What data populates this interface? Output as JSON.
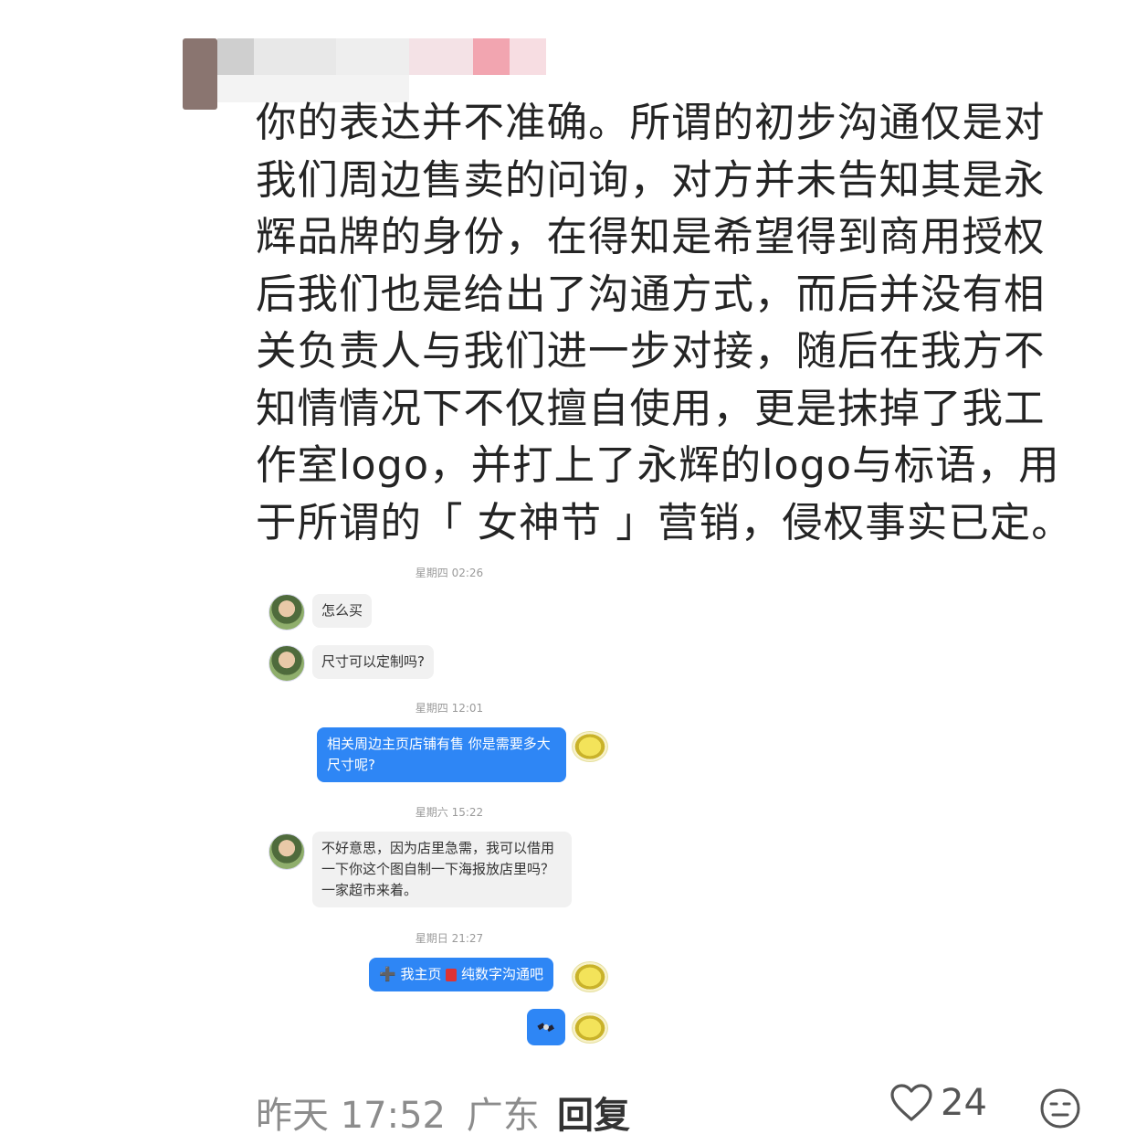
{
  "comment": {
    "text": "你的表达并不准确。所谓的初步沟通仅是对\n我们周边售卖的问询，对方并未告知其是永\n辉品牌的身份，在得知是希望得到商用授权\n后我们也是给出了沟通方式，而后并没有相\n关负责人与我们进一步对接，随后在我方不\n知情情况下不仅擅自使用，更是抹掉了我工\n作室logo，并打上了永辉的logo与标语，用\n于所谓的「 女神节 」营销，侵权事实已定。"
  },
  "chat": {
    "ts1": "星期四 02:26",
    "msg1": "怎么买",
    "msg2": "尺寸可以定制吗?",
    "ts2": "星期四 12:01",
    "msg3": "相关周边主页店铺有售 你是需要多大尺寸呢?",
    "ts3": "星期六 15:22",
    "msg4": "不好意思，因为店里急需，我可以借用一下你这个图自制一下海报放店里吗？一家超市来着。",
    "ts4": "星期日 21:27",
    "msg5_a": "我主页",
    "msg5_b": "纯数字沟通吧"
  },
  "footer": {
    "time": "昨天 17:52",
    "location": "广东",
    "reply": "回复",
    "likes": "24"
  },
  "icons": {
    "like": "heart-outline-icon",
    "emoji": "neutral-face-icon"
  },
  "colors": {
    "bubble_blue": "#2e86f5",
    "bubble_gray": "#f1f1f1"
  }
}
